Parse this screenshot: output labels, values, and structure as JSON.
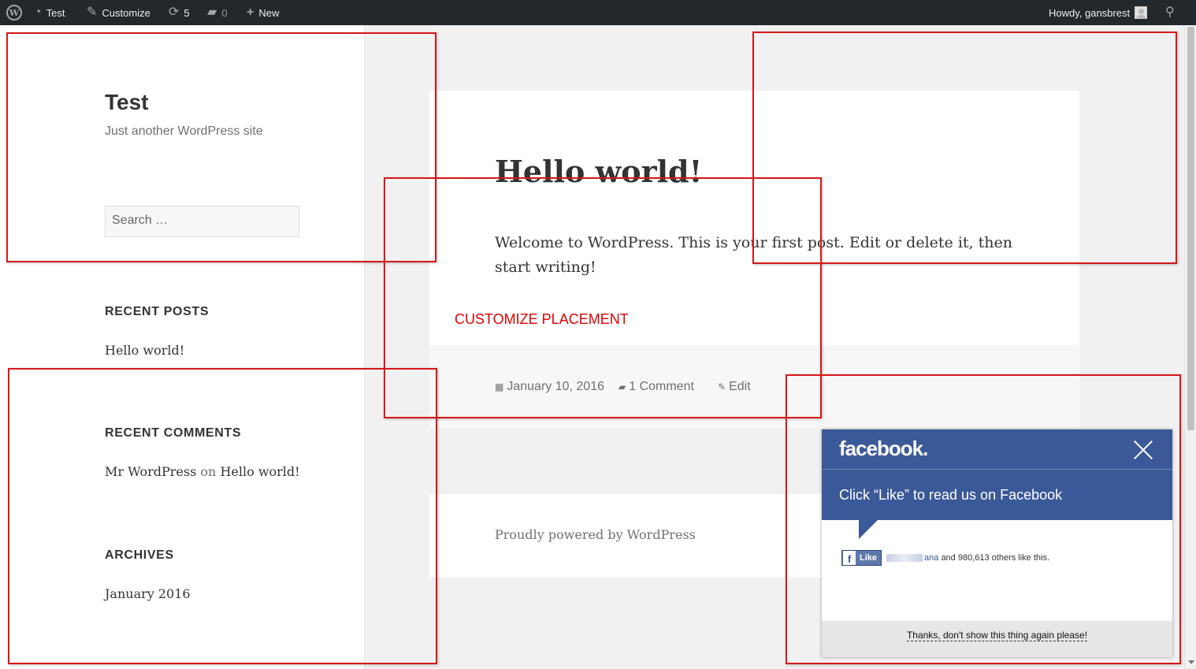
{
  "adminbar": {
    "site_name": "Test",
    "customize": "Customize",
    "updates_count": "5",
    "comments_count": "0",
    "new_label": "New",
    "howdy": "Howdy, gansbrest"
  },
  "sidebar": {
    "site_title": "Test",
    "site_description": "Just another WordPress site",
    "search_placeholder": "Search …",
    "recent_posts_title": "RECENT POSTS",
    "recent_posts": [
      "Hello world!"
    ],
    "recent_comments_title": "RECENT COMMENTS",
    "recent_comment": {
      "author": "Mr WordPress",
      "on": "on",
      "post": "Hello world!"
    },
    "archives_title": "ARCHIVES",
    "archives": [
      "January 2016"
    ]
  },
  "post": {
    "title": "Hello world!",
    "body": "Welcome to WordPress. This is your first post. Edit or delete it, then start writing!",
    "date": "January 10, 2016",
    "comments": "1 Comment",
    "edit": "Edit"
  },
  "footer": {
    "text": "Proudly powered by WordPress"
  },
  "overlay": {
    "label": "CUSTOMIZE PLACEMENT"
  },
  "facebook": {
    "brand": "facebook.",
    "cta": "Click “Like” to read us on Facebook",
    "like_button": "Like",
    "friend_suffix": "ana",
    "likes_text": "and 980,613 others like this.",
    "dismiss": "Thanks, don't show this thing again please!"
  },
  "colors": {
    "adminbar": "#23282d",
    "facebook_blue": "#3b5998",
    "placement_red": "#d61818"
  }
}
